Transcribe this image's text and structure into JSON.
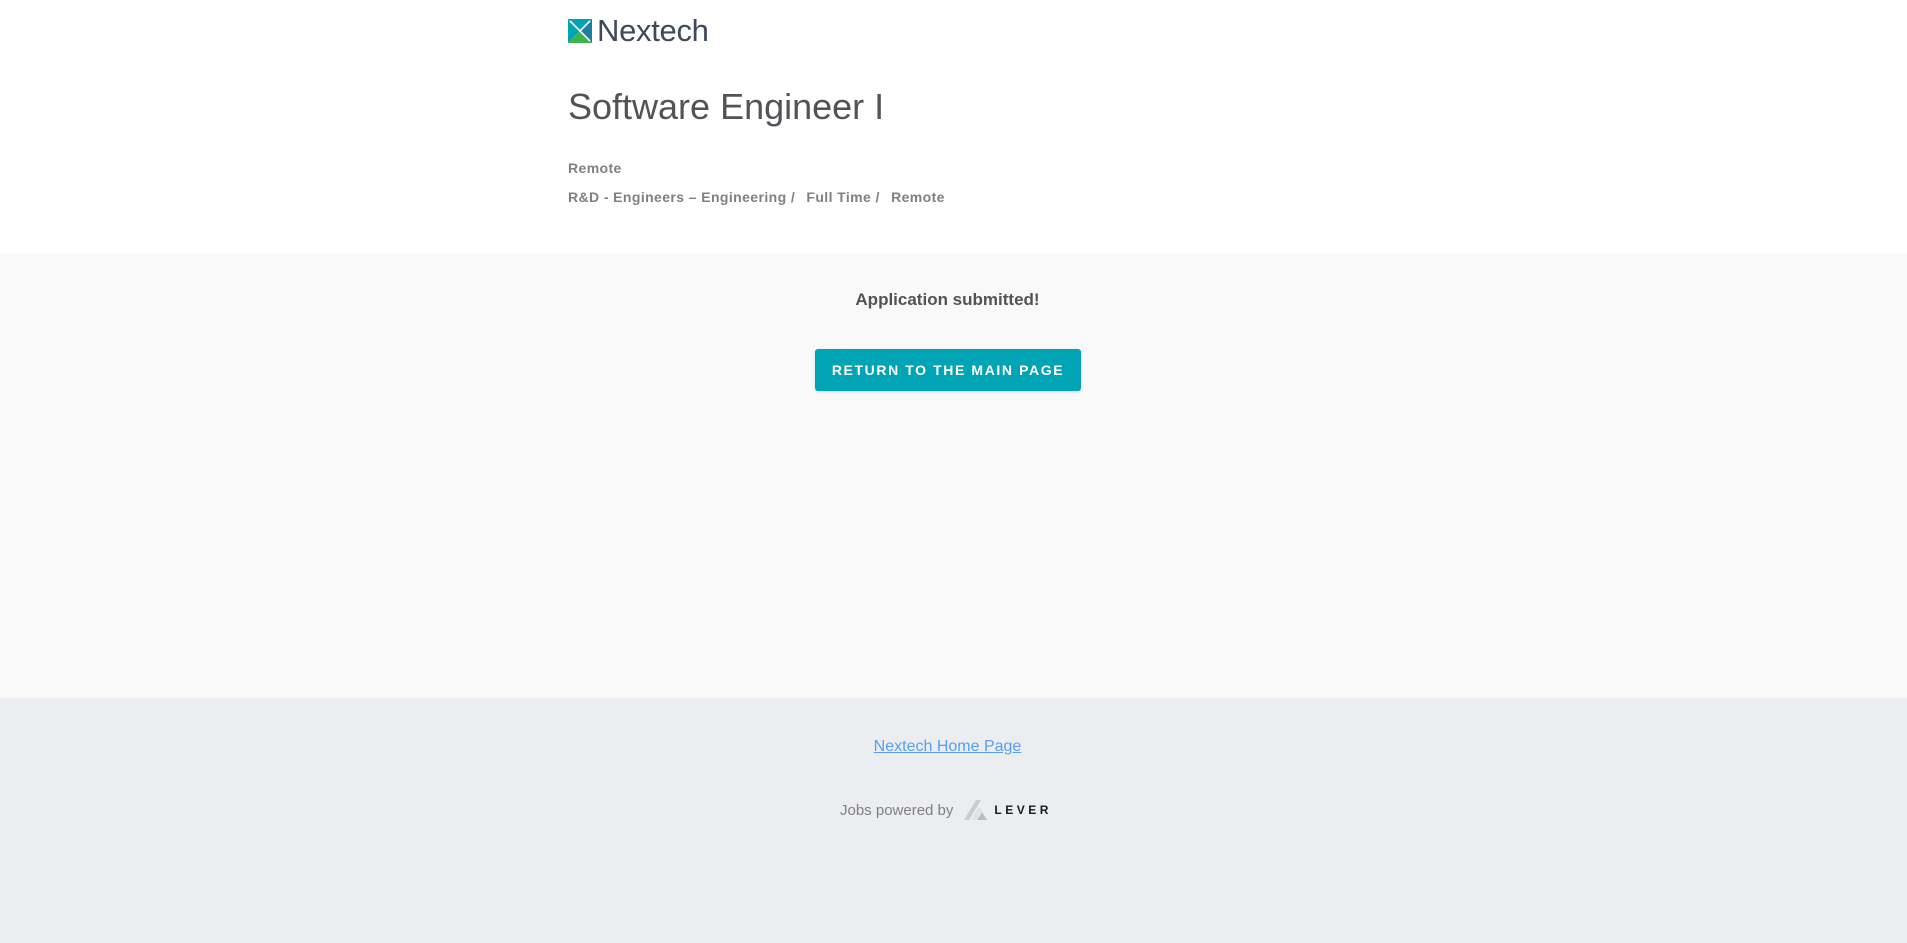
{
  "brand": {
    "name": "Nextech",
    "colors": {
      "teal": "#00a4b4",
      "green": "#3bb54a",
      "navy": "#3d4a5c"
    }
  },
  "posting": {
    "title": "Software Engineer I",
    "location": "Remote",
    "categories": [
      "R&D - Engineers – Engineering /",
      "Full Time /",
      "Remote"
    ]
  },
  "confirmation": {
    "message": "Application submitted!",
    "button_label": "RETURN TO THE MAIN PAGE"
  },
  "footer": {
    "home_link": "Nextech Home Page",
    "powered_by": "Jobs powered by",
    "lever_brand": "LEVER",
    "link_color": "#579eee"
  },
  "icons": {
    "company_logo": "nextech-logo-icon",
    "lever_logo": "lever-logo-icon"
  }
}
